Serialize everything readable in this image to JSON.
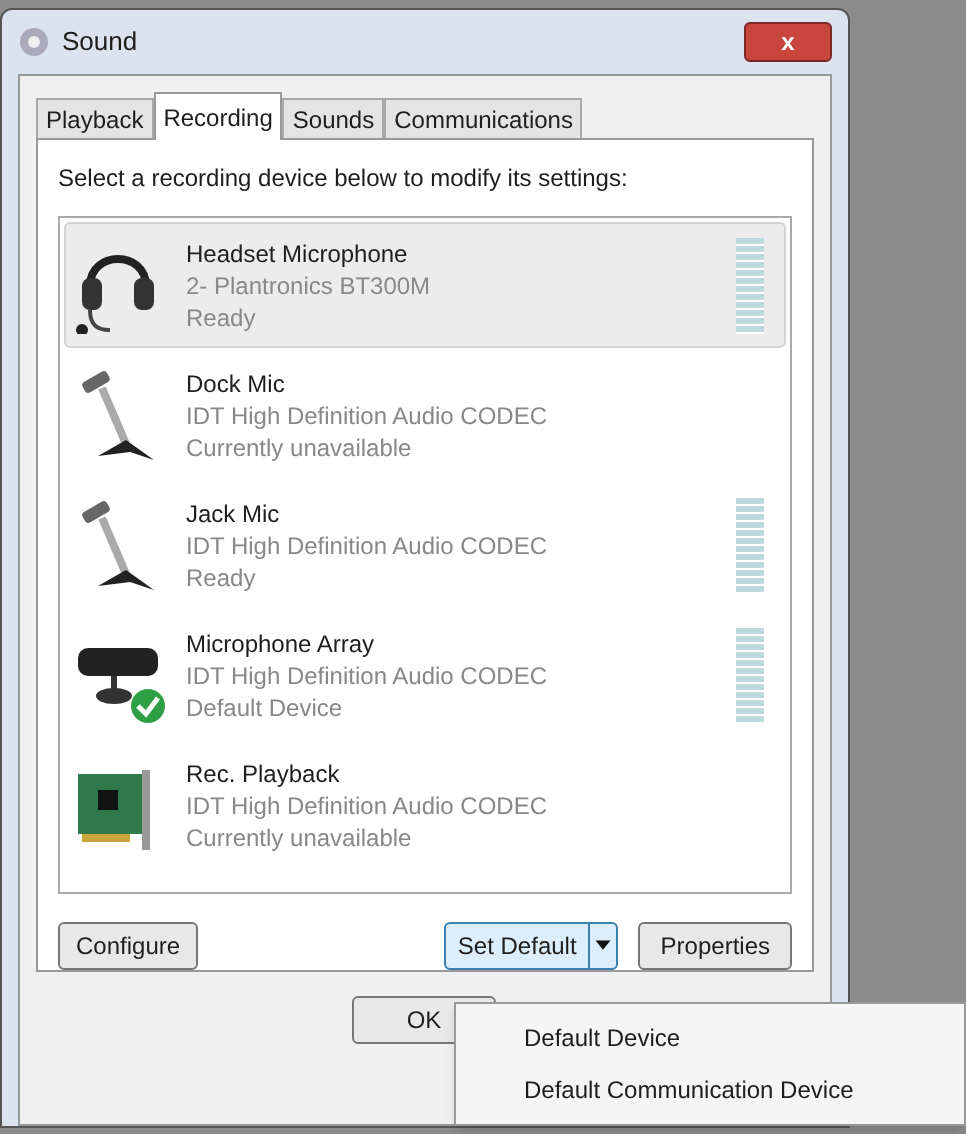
{
  "window": {
    "title": "Sound",
    "close": "x"
  },
  "tabs": [
    {
      "label": "Playback",
      "selected": false
    },
    {
      "label": "Recording",
      "selected": true
    },
    {
      "label": "Sounds",
      "selected": false
    },
    {
      "label": "Communications",
      "selected": false
    }
  ],
  "instruction": "Select a recording device below to modify its settings:",
  "devices": [
    {
      "kind": "headset",
      "name": "Headset Microphone",
      "driver": "2- Plantronics BT300M",
      "status": "Ready",
      "selected": true,
      "meter": true,
      "default": false
    },
    {
      "kind": "stand",
      "name": "Dock Mic",
      "driver": "IDT High Definition Audio CODEC",
      "status": "Currently unavailable",
      "selected": false,
      "meter": false,
      "default": false
    },
    {
      "kind": "stand",
      "name": "Jack Mic",
      "driver": "IDT High Definition Audio CODEC",
      "status": "Ready",
      "selected": false,
      "meter": true,
      "default": false
    },
    {
      "kind": "array",
      "name": "Microphone Array",
      "driver": "IDT High Definition Audio CODEC",
      "status": "Default Device",
      "selected": false,
      "meter": true,
      "default": true
    },
    {
      "kind": "card",
      "name": "Rec. Playback",
      "driver": "IDT High Definition Audio CODEC",
      "status": "Currently unavailable",
      "selected": false,
      "meter": false,
      "default": false
    }
  ],
  "buttons": {
    "configure": "Configure",
    "set_default": "Set Default",
    "properties": "Properties",
    "ok": "OK"
  },
  "menu": {
    "items": [
      "Default Device",
      "Default Communication Device"
    ]
  }
}
